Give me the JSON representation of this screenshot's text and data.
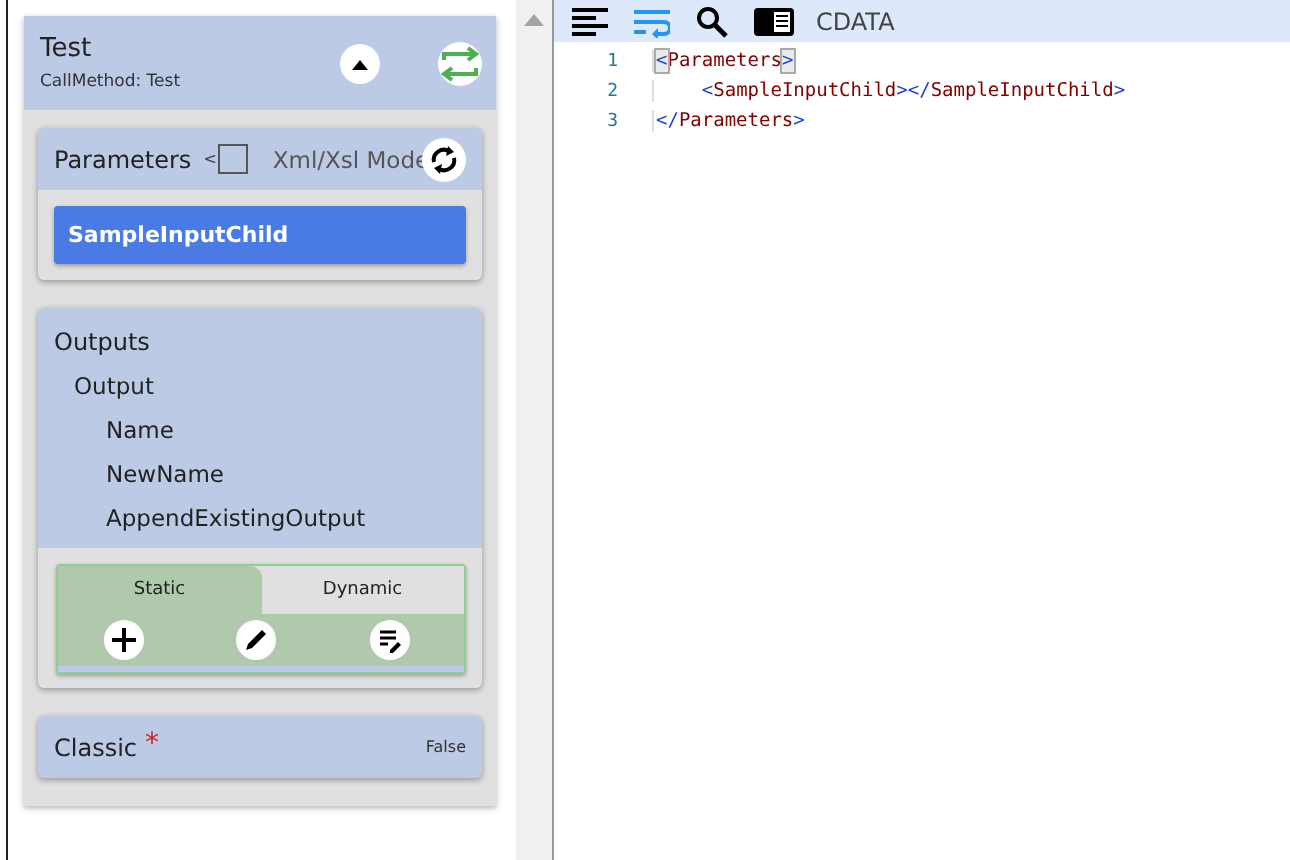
{
  "method_card": {
    "title": "Test",
    "subtitle": "CallMethod: Test",
    "expanded": true
  },
  "parameters": {
    "title": "Parameters",
    "toggle_mark": "<",
    "xml_mode": {
      "label": "Xml/Xsl Mode",
      "checked": false
    },
    "items": [
      "SampleInputChild"
    ]
  },
  "outputs": {
    "title": "Outputs",
    "tree": [
      {
        "label": "Output",
        "children": [
          {
            "label": "Name"
          },
          {
            "label": "NewName"
          },
          {
            "label": "AppendExistingOutput"
          }
        ]
      }
    ],
    "tabs": [
      {
        "label": "Static",
        "selected": true
      },
      {
        "label": "Dynamic",
        "selected": false
      }
    ]
  },
  "classic": {
    "label": "Classic",
    "required_mark": "*",
    "value": "False"
  },
  "editor": {
    "word_wrap": true,
    "cdata_label": "CDATA",
    "lines": [
      {
        "number": "1",
        "text": "<Parameters>",
        "bracket_match": true
      },
      {
        "number": "2",
        "text": "    <SampleInputChild></SampleInputChild>",
        "bracket_match": false
      },
      {
        "number": "3",
        "text": "</Parameters>",
        "bracket_match": false
      }
    ]
  }
}
